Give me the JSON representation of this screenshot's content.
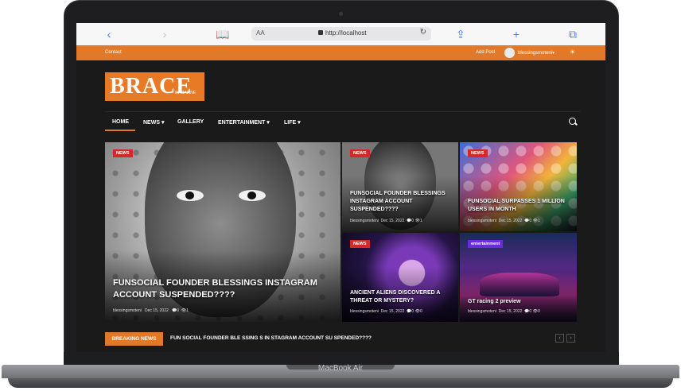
{
  "browser": {
    "url": "http://localhost",
    "text_size_label": "AA",
    "back_icon": "chevron-left",
    "forward_icon": "chevron-right",
    "bookmarks_icon": "book",
    "share_icon": "share",
    "new_tab_icon": "plus",
    "tabs_icon": "tabs"
  },
  "topbar": {
    "contact": "Contact",
    "add_post": "Add Post",
    "username": "blessingsmoteni",
    "color": "#e07a2a"
  },
  "logo": {
    "title": "BRACE",
    "subtitle": "MAGAZINE"
  },
  "nav": {
    "items": [
      {
        "label": "HOME"
      },
      {
        "label": "NEWS ▾"
      },
      {
        "label": "GALLERY"
      },
      {
        "label": "ENTERTAINMENT ▾"
      },
      {
        "label": "LIFE ▾"
      }
    ]
  },
  "posts": [
    {
      "category": "NEWS",
      "title": "FUNSOCIAL FOUNDER BLESSINGS INSTAGRAM ACCOUNT SUSPENDED????",
      "author": "blessingsmoteni",
      "date": "Dec 15, 2022",
      "comments": "0",
      "views": "1"
    },
    {
      "category": "NEWS",
      "title": "FUNSOCIAL FOUNDER BLESSINGS INSTAGRAM ACCOUNT SUSPENDED????",
      "author": "blessingsmoteni",
      "date": "Dec 15, 2022",
      "comments": "0",
      "views": "1"
    },
    {
      "category": "NEWS",
      "title": "FUNSOCIAL SURPASSES 1 MILLION USERS IN MONTH",
      "author": "blessingsmoteni",
      "date": "Dec 15, 2022",
      "comments": "0",
      "views": "1"
    },
    {
      "category": "NEWS",
      "title": "ANCIENT ALIENS DISCOVERED A THREAT OR MYSTERY?",
      "author": "blessingsmoteni",
      "date": "Dec 15, 2022",
      "comments": "0",
      "views": "0"
    },
    {
      "category": "entertainment",
      "title": "GT racing 2 preview",
      "author": "blessingsmoteni",
      "date": "Dec 15, 2022",
      "comments": "0",
      "views": "0"
    }
  ],
  "breaking": {
    "label": "BREAKING NEWS",
    "text": "FUN SOCIAL FOUNDER BLE SSING S IN STAGRAM ACCOUNT SU SPENDED????"
  },
  "device": {
    "label": "MacBook Air"
  }
}
